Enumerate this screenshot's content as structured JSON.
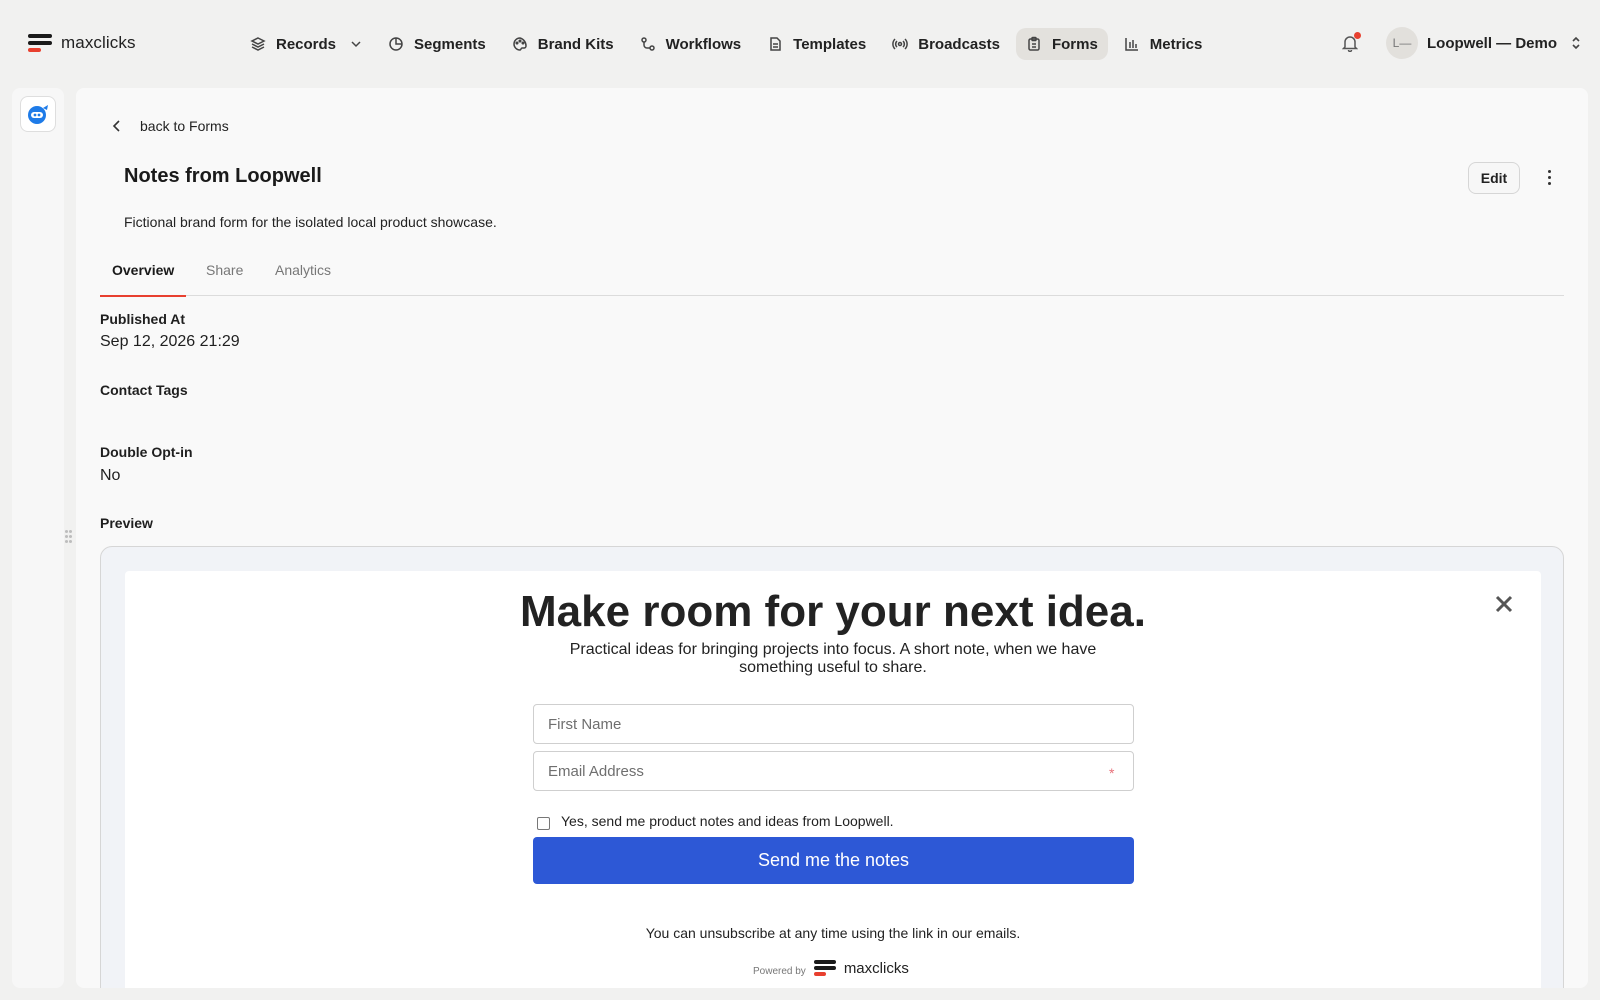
{
  "brand": {
    "name": "maxclicks",
    "accent": "#e8402f"
  },
  "nav": {
    "items": [
      {
        "label": "Records",
        "icon": "layers-icon"
      },
      {
        "label": "Segments",
        "icon": "pie-icon"
      },
      {
        "label": "Brand Kits",
        "icon": "palette-icon"
      },
      {
        "label": "Workflows",
        "icon": "workflow-icon"
      },
      {
        "label": "Templates",
        "icon": "document-icon"
      },
      {
        "label": "Broadcasts",
        "icon": "broadcast-icon"
      },
      {
        "label": "Forms",
        "icon": "clipboard-icon",
        "active": true
      },
      {
        "label": "Metrics",
        "icon": "bar-chart-icon"
      }
    ]
  },
  "account": {
    "avatar_initials": "L—",
    "name": "Loopwell — Demo"
  },
  "page": {
    "back_label": "back to Forms",
    "title": "Notes from Loopwell",
    "edit_label": "Edit",
    "description": "Fictional brand form for the isolated local product showcase.",
    "tabs": [
      "Overview",
      "Share",
      "Analytics"
    ],
    "active_tab": "Overview"
  },
  "details": {
    "published_label": "Published At",
    "published_value": "Sep 12, 2026 21:29",
    "tags_label": "Contact Tags",
    "tags_value": "",
    "optin_label": "Double Opt-in",
    "optin_value": "No",
    "preview_label": "Preview"
  },
  "preview": {
    "headline": "Make room for your next idea.",
    "subtext": "Practical ideas for bringing projects into focus. A short note, when we have something useful to share.",
    "first_name_placeholder": "First Name",
    "email_placeholder": "Email Address",
    "required_mark": "*",
    "consent_label": "Yes, send me product notes and ideas from Loopwell.",
    "submit_label": "Send me the notes",
    "submit_color": "#2d58d6",
    "footer": "You can unsubscribe at any time using the link in our emails.",
    "powered_by": "Powered by",
    "powered_brand": "maxclicks"
  }
}
